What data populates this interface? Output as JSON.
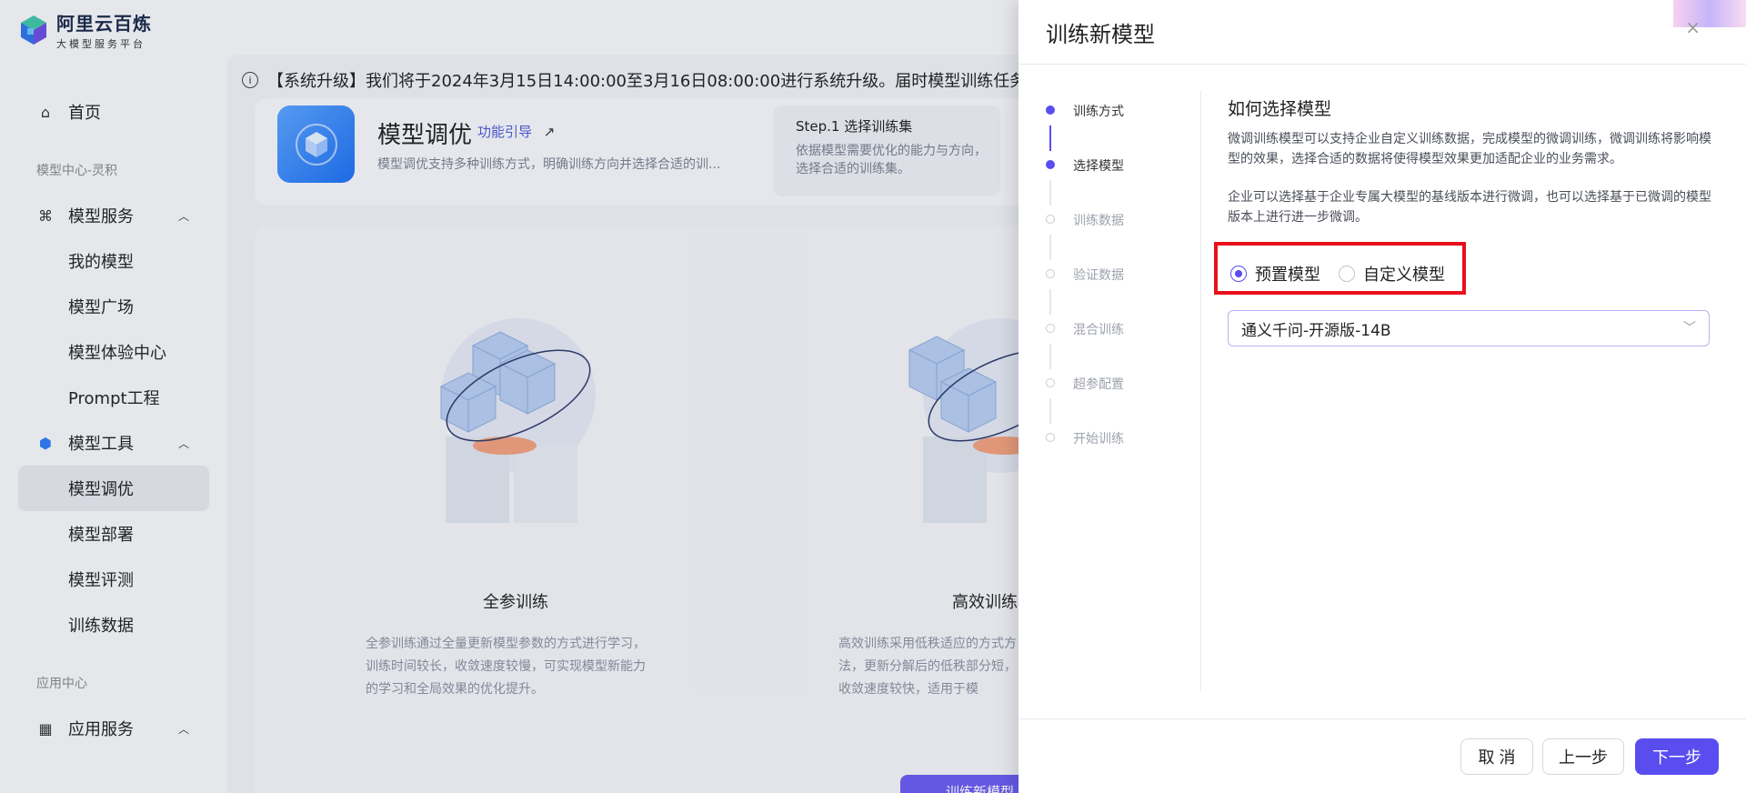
{
  "logo": {
    "title": "阿里云百炼",
    "subtitle": "大模型服务平台"
  },
  "sidebar": {
    "home": "首页",
    "group1": "模型中心-灵积",
    "model_service": "模型服务",
    "model_service_items": [
      "我的模型",
      "模型广场",
      "模型体验中心",
      "Prompt工程"
    ],
    "model_tools": "模型工具",
    "model_tools_items": [
      "模型调优",
      "模型部署",
      "模型评测",
      "训练数据"
    ],
    "group2": "应用中心",
    "app_service": "应用服务"
  },
  "notice": {
    "text": "【系统升级】我们将于2024年3月15日14:00:00至3月16日08:00:00进行系统升级。届时模型训练任务可能会"
  },
  "intro": {
    "title": "模型调优",
    "guide": "功能引导",
    "guide_arrow": "↗",
    "desc": "模型调优支持多种训练方式，明确训练方向并选择合适的训...",
    "step_title": "Step.1 选择训练集",
    "step_desc": "依据模型需要优化的能力与方向，选择合适的训练集。"
  },
  "methods": [
    {
      "title": "全参训练",
      "desc": "全参训练通过全量更新模型参数的方式进行学习，训练时间较长，收敛速度较慢，可实现模型新能力的学习和全局效果的优化提升。"
    },
    {
      "title": "高效训练",
      "desc": "高效训练采用低秩适应的方式方法，更新分解后的低秩部分短，收敛速度较快，适用于模"
    }
  ],
  "background_button": "训练新模型",
  "drawer": {
    "title": "训练新模型",
    "close": "×",
    "steps": [
      {
        "label": "训练方式",
        "state": "done"
      },
      {
        "label": "选择模型",
        "state": "current"
      },
      {
        "label": "训练数据",
        "state": "todo"
      },
      {
        "label": "验证数据",
        "state": "todo"
      },
      {
        "label": "混合训练",
        "state": "todo"
      },
      {
        "label": "超参配置",
        "state": "todo"
      },
      {
        "label": "开始训练",
        "state": "todo"
      }
    ],
    "section_title": "如何选择模型",
    "para1": "微调训练模型可以支持企业自定义训练数据，完成模型的微调训练，微调训练将影响模型的效果，选择合适的数据将使得模型效果更加适配企业的业务需求。",
    "para2": "企业可以选择基于企业专属大模型的基线版本进行微调，也可以选择基于已微调的模型版本上进行进一步微调。",
    "radio_preset": "预置模型",
    "radio_custom": "自定义模型",
    "selected_radio": "预置模型",
    "select_value": "通义千问-开源版-14B",
    "btn_cancel": "取 消",
    "btn_prev": "上一步",
    "btn_next": "下一步"
  },
  "colors": {
    "primary": "#5a4df0",
    "highlight": "#e8101c"
  }
}
